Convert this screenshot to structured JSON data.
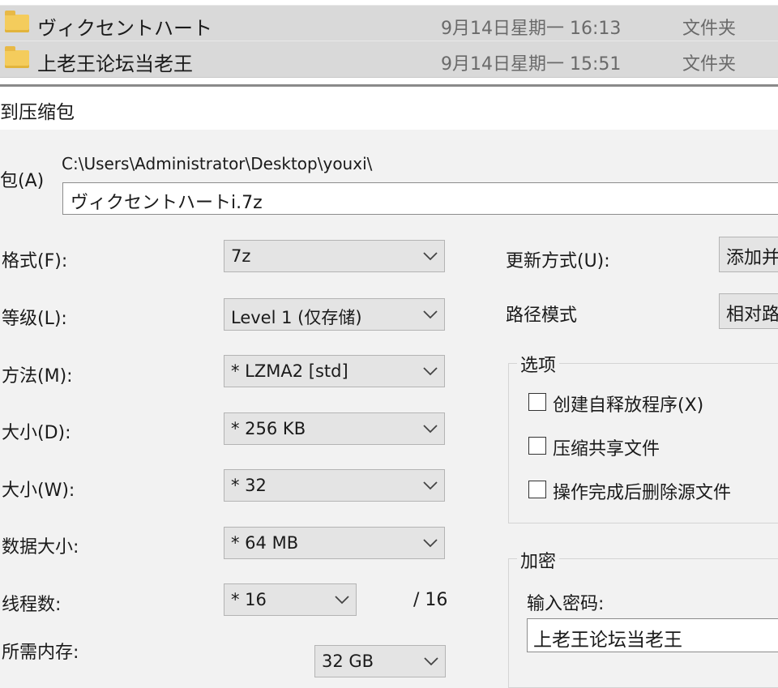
{
  "explorer": {
    "files": [
      {
        "name": "ヴィクセントハート",
        "date": "9月14日星期一 16:13",
        "type": "文件夹",
        "icon": "folder-icon"
      },
      {
        "name": "上老王论坛当老王",
        "date": "9月14日星期一 15:51",
        "type": "文件夹",
        "icon": "folder-icon"
      }
    ]
  },
  "dialog": {
    "title": "到压缩包",
    "archive_label": "包(A)",
    "archive_path": "C:\\Users\\Administrator\\Desktop\\youxi\\",
    "archive_name": "ヴィクセントハートi.7z",
    "format_label": "格式(F):",
    "format_value": "7z",
    "level_label": "等级(L):",
    "level_value": "Level 1 (仅存储)",
    "method_label": "方法(M):",
    "method_value": "*  LZMA2 [std]",
    "dict_label": "大小(D):",
    "dict_value": "*  256 KB",
    "word_label": "大小(W):",
    "word_value": "*  32",
    "solid_label": "数据大小:",
    "solid_value": "*  64 MB",
    "threads_label": "线程数:",
    "threads_value": "*  16",
    "threads_max": "/ 16",
    "memory_label": "所需内存:",
    "memory_value": "32 GB",
    "update_label": "更新方式(U):",
    "update_value": "添加并",
    "pathmode_label": "路径模式",
    "pathmode_value": "相对路",
    "options": {
      "title": "选项",
      "sfx": {
        "label": "创建自释放程序(X)",
        "checked": false
      },
      "shared": {
        "label": "压缩共享文件",
        "checked": false
      },
      "delete": {
        "label": "操作完成后删除源文件",
        "checked": false
      }
    },
    "encryption": {
      "title": "加密",
      "password_label": "输入密码:",
      "password_value": "上老王论坛当老王"
    }
  }
}
